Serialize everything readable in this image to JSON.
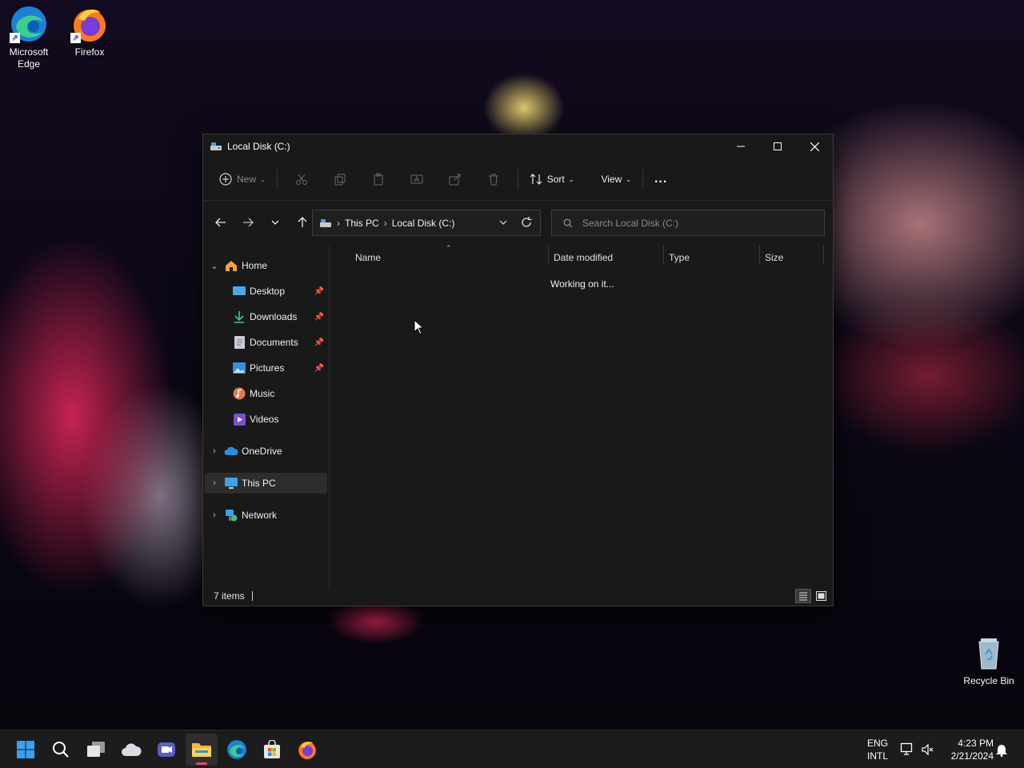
{
  "desktop": {
    "icons": [
      {
        "label": "Microsoft Edge"
      },
      {
        "label": "Firefox"
      },
      {
        "label": "Recycle Bin"
      }
    ]
  },
  "window": {
    "title": "Local Disk (C:)",
    "toolbar": {
      "new_label": "New",
      "sort_label": "Sort",
      "view_label": "View",
      "more_label": "..."
    },
    "address": {
      "crumbs": [
        "This PC",
        "Local Disk (C:)"
      ]
    },
    "search": {
      "placeholder": "Search Local Disk (C:)"
    },
    "sidebar": {
      "items": [
        {
          "label": "Home",
          "icon": "home-icon"
        },
        {
          "label": "Desktop",
          "icon": "desktop-icon",
          "pinned": true
        },
        {
          "label": "Downloads",
          "icon": "download-icon",
          "pinned": true
        },
        {
          "label": "Documents",
          "icon": "document-icon",
          "pinned": true
        },
        {
          "label": "Pictures",
          "icon": "pictures-icon",
          "pinned": true
        },
        {
          "label": "Music",
          "icon": "music-icon"
        },
        {
          "label": "Videos",
          "icon": "videos-icon"
        },
        {
          "label": "OneDrive",
          "icon": "cloud-icon"
        },
        {
          "label": "This PC",
          "icon": "monitor-icon",
          "selected": true
        },
        {
          "label": "Network",
          "icon": "network-icon"
        }
      ]
    },
    "columns": [
      "Name",
      "Date modified",
      "Type",
      "Size"
    ],
    "status_message": "Working on it...",
    "statusbar": {
      "item_count": "7 items"
    }
  },
  "taskbar": {
    "language": "ENG",
    "layout": "INTL",
    "time": "4:23 PM",
    "date": "2/21/2024"
  },
  "colors": {
    "accent": "#e84a57",
    "window_bg": "#191919",
    "taskbar_bg": "#1c1c1c"
  }
}
